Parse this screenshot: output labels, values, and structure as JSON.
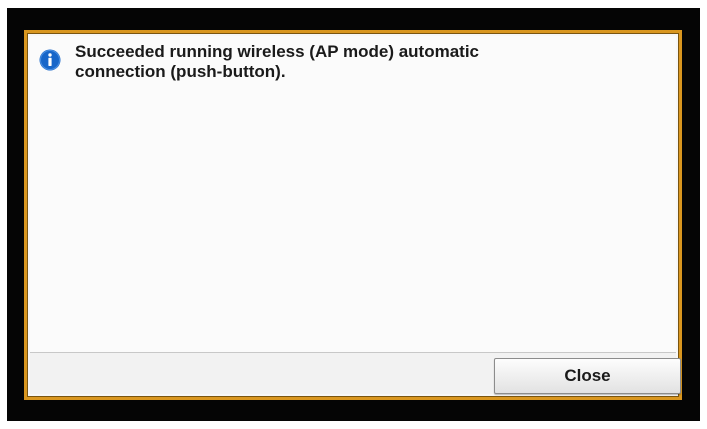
{
  "dialog": {
    "icon": "info-icon",
    "message_line1": "Succeeded running wireless (AP mode) automatic",
    "message_line2": "connection (push-button).",
    "close_label": "Close"
  },
  "colors": {
    "screen_bezel": "#050505",
    "dialog_border": "#d9961f",
    "icon_blue": "#1766c9",
    "dialog_background": "#f7f7f7"
  }
}
